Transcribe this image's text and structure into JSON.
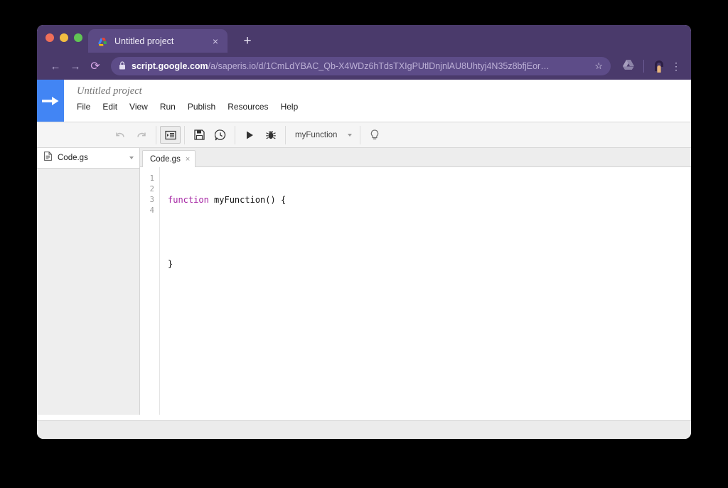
{
  "browser": {
    "tab": {
      "title": "Untitled project",
      "favicon": "apps-script-favicon",
      "close_label": "×"
    },
    "new_tab_label": "+",
    "nav": {
      "back_label": "←",
      "forward_label": "→",
      "reload_label": "⟳"
    },
    "omnibox": {
      "lock_icon": "lock-icon",
      "url_host": "script.google.com",
      "url_path": "/a/saperis.io/d/1CmLdYBAC_Qb-X4WDz6hTdsTXIgPUtlDnjnlAU8Uhtyj4N35z8bfjEor…",
      "star_label": "☆"
    },
    "toolbar_right": {
      "drive_icon": "google-drive-icon",
      "avatar": "user-avatar",
      "menu_label": "⋮"
    },
    "colors": {
      "tabstrip": "#4a3a6b",
      "active_tab": "#5b4a84",
      "omnibox": "#5d4c88"
    }
  },
  "app": {
    "logo": "apps-script-arrow-logo",
    "logo_color": "#4285f4",
    "project_title": "Untitled project",
    "menus": [
      {
        "label": "File"
      },
      {
        "label": "Edit"
      },
      {
        "label": "View"
      },
      {
        "label": "Run"
      },
      {
        "label": "Publish"
      },
      {
        "label": "Resources"
      },
      {
        "label": "Help"
      }
    ],
    "toolbar": {
      "undo": {
        "icon": "undo-icon",
        "enabled": false
      },
      "redo": {
        "icon": "redo-icon",
        "enabled": false
      },
      "indent": {
        "icon": "indent-icon",
        "active": true
      },
      "save": {
        "icon": "save-floppy-icon"
      },
      "history": {
        "icon": "version-history-icon"
      },
      "run": {
        "icon": "run-play-icon"
      },
      "debug": {
        "icon": "debug-bug-icon"
      },
      "function_select": {
        "value": "myFunction"
      },
      "help_hint": {
        "icon": "lightbulb-icon"
      }
    },
    "sidebar": {
      "file": {
        "icon": "file-icon",
        "name": "Code.gs",
        "caret": "dropdown-caret-icon"
      }
    },
    "editor": {
      "tab": {
        "label": "Code.gs",
        "close": "×"
      },
      "line_numbers": [
        "1",
        "2",
        "3",
        "4"
      ],
      "code": {
        "keyword": "function",
        "rest_line1": " myFunction() {",
        "line3": "}"
      },
      "keyword_color": "#a626a4"
    },
    "statusbar": {
      "text": ""
    }
  }
}
